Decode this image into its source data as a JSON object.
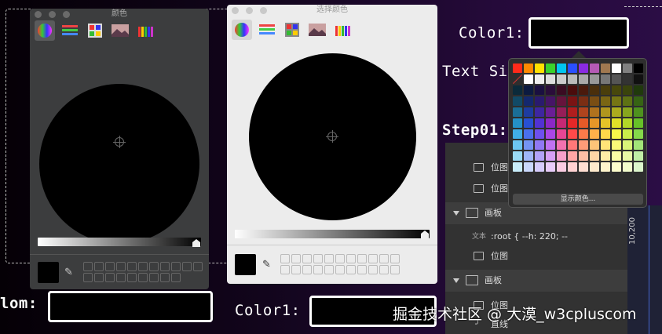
{
  "left_panel": {
    "title": "颜色"
  },
  "middle_panel": {
    "title": "选择颜色"
  },
  "palette": {
    "show_colors_button": "显示颜色...",
    "rows": [
      [
        "#ff2a1a",
        "#ff8a00",
        "#ffe100",
        "#3ad22c",
        "#00c6f0",
        "#2a4fff",
        "#8a2be2",
        "#b55ab5",
        "#a07850",
        "#ffffff",
        "#808080",
        "#000000"
      ],
      [
        "#000000",
        "#ffffff",
        "#eeeeee",
        "#dddddd",
        "#cccccc",
        "#bbbbbb",
        "#aaaaaa",
        "#999999",
        "#777777",
        "#555555",
        "#333333",
        "#111111"
      ],
      [
        "#0b2a3a",
        "#0c1a40",
        "#1a0f40",
        "#2a0d3a",
        "#3a0c22",
        "#4a0c0c",
        "#4a1a0c",
        "#4a2f0c",
        "#4a3e0c",
        "#48480c",
        "#3a440c",
        "#203a0c"
      ],
      [
        "#114a66",
        "#14286e",
        "#2a1a6e",
        "#461566",
        "#66143c",
        "#7a1414",
        "#7a2e14",
        "#7a4e14",
        "#7a6614",
        "#767614",
        "#5e7214",
        "#366414"
      ],
      [
        "#1a6e96",
        "#1e3ca0",
        "#3e26a0",
        "#6a1e96",
        "#961e58",
        "#b01e1e",
        "#b0441e",
        "#b0721e",
        "#b0961e",
        "#acac1e",
        "#88a61e",
        "#4e921e"
      ],
      [
        "#2490c6",
        "#2850d2",
        "#5232d2",
        "#8c28c6",
        "#c62874",
        "#e62828",
        "#e65a28",
        "#e69628",
        "#e6c428",
        "#e0e028",
        "#b2d828",
        "#66c028"
      ],
      [
        "#40aee6",
        "#4a70ee",
        "#6e50ee",
        "#aa46e6",
        "#e64694",
        "#ff4a4a",
        "#ff7a4a",
        "#ffb04a",
        "#ffd84a",
        "#f6f64a",
        "#caee4a",
        "#84d84a"
      ],
      [
        "#6cc6f2",
        "#7494f4",
        "#9078f4",
        "#c072f2",
        "#f272b0",
        "#ff7878",
        "#ff9c78",
        "#ffc478",
        "#ffe478",
        "#fafa78",
        "#daf478",
        "#a2e478"
      ],
      [
        "#9adaf6",
        "#a0b6f8",
        "#b2a2f8",
        "#d6a0f6",
        "#f6a0ca",
        "#ffa6a6",
        "#ffbea6",
        "#ffd6a6",
        "#ffeca6",
        "#fcfca6",
        "#e8f8a6",
        "#c0eea6"
      ],
      [
        "#c8ecfa",
        "#cad8fc",
        "#d6ccfc",
        "#e8ccfa",
        "#facce2",
        "#ffd2d2",
        "#ffded2",
        "#ffeacc",
        "#fff4cc",
        "#fefecc",
        "#f2fccc",
        "#dcf6cc"
      ]
    ]
  },
  "labels": {
    "color1_top": "Color1:",
    "text_size": "Text Siz",
    "step01": "Step01:",
    "color1_bottom": "Color1:",
    "bottom_left": "lom:"
  },
  "layers": {
    "items": [
      {
        "kind": "row",
        "label": "位图"
      },
      {
        "kind": "row",
        "label": "位图"
      },
      {
        "kind": "group",
        "label": "画板"
      },
      {
        "kind": "text",
        "prefix": "文本",
        "label": ":root { --h: 220; --"
      },
      {
        "kind": "row",
        "label": "位图"
      },
      {
        "kind": "group",
        "label": "画板"
      },
      {
        "kind": "row",
        "label": "位图"
      },
      {
        "kind": "row",
        "label": "直线"
      }
    ]
  },
  "ruler": {
    "value": "10,200"
  },
  "watermark": "掘金技术社区 @ 大漠_w3cpluscom",
  "colors": {
    "dark_panel_bg": "#3c3d3e",
    "light_panel_bg": "#ececec",
    "palette_bg": "#2e2e2e"
  }
}
